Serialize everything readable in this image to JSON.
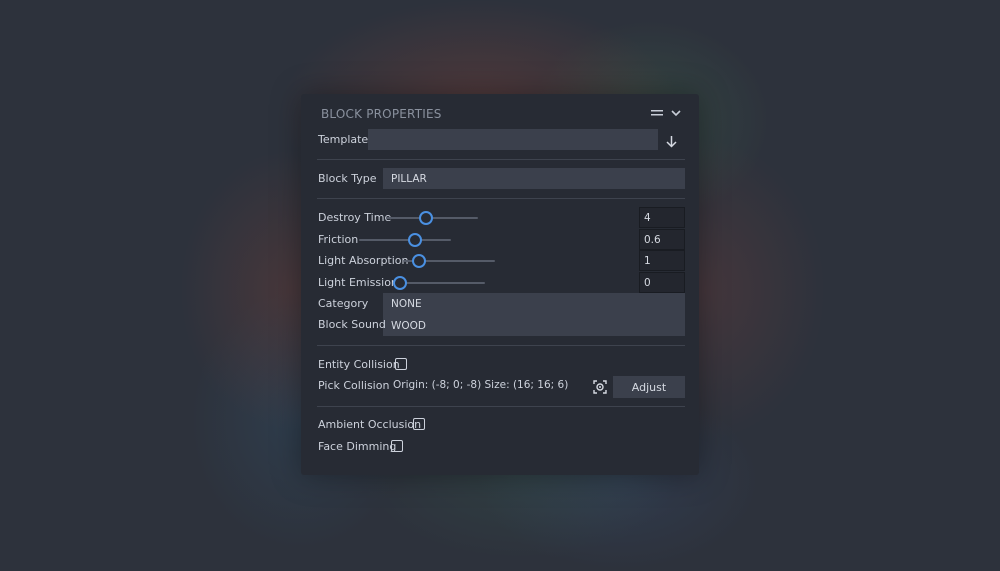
{
  "panel": {
    "title": "BLOCK PROPERTIES",
    "icons": [
      "menu-icon",
      "chevron-down-icon"
    ]
  },
  "template": {
    "label": "Template",
    "value": "",
    "icon": "download-arrow-icon"
  },
  "block_type": {
    "label": "Block Type",
    "value": "PILLAR"
  },
  "sliders": [
    {
      "label": "Destroy Time",
      "value": "4",
      "level": 0.42
    },
    {
      "label": "Friction",
      "value": "0.6",
      "level": 0.63
    },
    {
      "label": "Light Absorption",
      "value": "1",
      "level": 0.12
    },
    {
      "label": "Light Emission",
      "value": "0",
      "level": 0.0
    }
  ],
  "category": {
    "label": "Category",
    "value": "NONE"
  },
  "block_sound": {
    "label": "Block Sound",
    "value": "WOOD"
  },
  "entity_collision": {
    "label": "Entity Collision",
    "checked": false
  },
  "pick_collision": {
    "label": "Pick Collision",
    "info": "Origin: (-8; 0; -8) Size: (16; 16; 6)",
    "icon": "focus-target-icon",
    "button": "Adjust"
  },
  "ambient_occlusion": {
    "label": "Ambient Occlusion",
    "checked": false
  },
  "face_dimming": {
    "label": "Face Dimming",
    "checked": false
  },
  "colors": {
    "accent": "#4a90e2",
    "panel": "#272b34",
    "field": "#3b404c"
  }
}
